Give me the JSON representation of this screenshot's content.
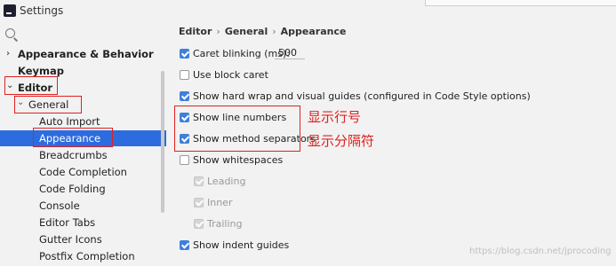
{
  "window": {
    "title": "Settings"
  },
  "sidebar": {
    "items": [
      {
        "label": "Appearance & Behavior",
        "arrow": "›"
      },
      {
        "label": "Keymap"
      },
      {
        "label": "Editor",
        "arrow": "⌄"
      },
      {
        "label": "General",
        "arrow": "⌄"
      },
      {
        "label": "Auto Import"
      },
      {
        "label": "Appearance"
      },
      {
        "label": "Breadcrumbs"
      },
      {
        "label": "Code Completion"
      },
      {
        "label": "Code Folding"
      },
      {
        "label": "Console"
      },
      {
        "label": "Editor Tabs"
      },
      {
        "label": "Gutter Icons"
      },
      {
        "label": "Postfix Completion"
      }
    ]
  },
  "breadcrumb": {
    "items": [
      "Editor",
      "General",
      "Appearance"
    ],
    "separator": "›"
  },
  "options": {
    "caret_blinking": {
      "label": "Caret blinking (ms):",
      "value": "500",
      "checked": true
    },
    "block_caret": {
      "label": "Use block caret",
      "checked": false
    },
    "hard_wrap": {
      "label": "Show hard wrap and visual guides (configured in Code Style options)",
      "checked": true
    },
    "line_numbers": {
      "label": "Show line numbers",
      "checked": true
    },
    "method_separators": {
      "label": "Show method separators",
      "checked": true
    },
    "whitespaces": {
      "label": "Show whitespaces",
      "checked": false
    },
    "leading": {
      "label": "Leading",
      "checked": true,
      "disabled": true
    },
    "inner": {
      "label": "Inner",
      "checked": true,
      "disabled": true
    },
    "trailing": {
      "label": "Trailing",
      "checked": true,
      "disabled": true
    },
    "indent_guides": {
      "label": "Show indent guides",
      "checked": true
    }
  },
  "annotations": {
    "line_numbers": "显示行号",
    "method_separators": "显示分隔符"
  },
  "watermark": "https://blog.csdn.net/jprocoding",
  "colors": {
    "selection": "#2d6cdf",
    "checkbox": "#3f7fd9",
    "annotation": "#e02020"
  }
}
